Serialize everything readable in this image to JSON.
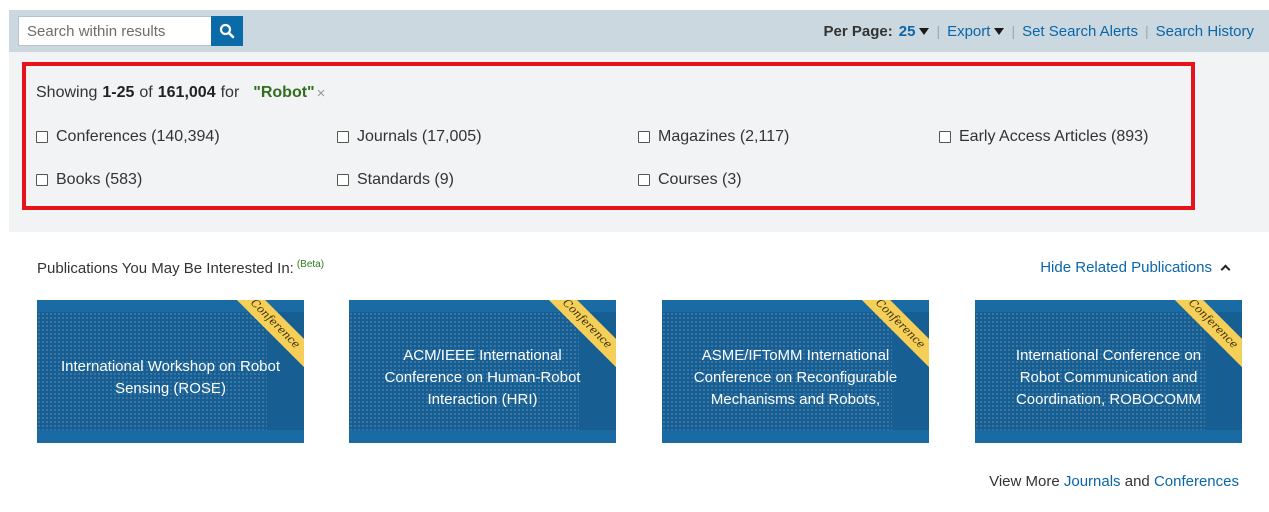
{
  "search": {
    "placeholder": "Search within results"
  },
  "toolbar": {
    "per_page_label": "Per Page:",
    "per_page_value": "25",
    "export_label": "Export",
    "set_alerts_label": "Set Search Alerts",
    "history_label": "Search History"
  },
  "results": {
    "showing_prefix": "Showing",
    "range": "1-25",
    "of": "of",
    "total": "161,004",
    "for": "for",
    "query": "\"Robot\"",
    "facets": [
      {
        "label": "Conferences (140,394)"
      },
      {
        "label": "Journals (17,005)"
      },
      {
        "label": "Magazines (2,117)"
      },
      {
        "label": "Early Access Articles (893)"
      },
      {
        "label": "Books (583)"
      },
      {
        "label": "Standards (9)"
      },
      {
        "label": "Courses (3)"
      }
    ]
  },
  "publications": {
    "title": "Publications You May Be Interested In:",
    "beta": "(Beta)",
    "hide_label": "Hide Related Publications",
    "cards": [
      {
        "title": "International Workshop on Robot Sensing (ROSE)",
        "ribbon": "Conference"
      },
      {
        "title": "ACM/IEEE International Conference on Human-Robot Interaction (HRI)",
        "ribbon": "Conference"
      },
      {
        "title": "ASME/IFToMM International Conference on Reconfigurable Mechanisms and Robots,",
        "ribbon": "Conference"
      },
      {
        "title": "International Conference on Robot Communication and Coordination, ROBOCOMM",
        "ribbon": "Conference"
      }
    ],
    "view_more_prefix": "View More",
    "journals_link": "Journals",
    "and": "and",
    "conferences_link": "Conferences"
  },
  "colors": {
    "accent": "#0a66a8",
    "highlight": "#e6141a",
    "ribbon": "#f5cf58",
    "card": "#1a6ba3"
  }
}
